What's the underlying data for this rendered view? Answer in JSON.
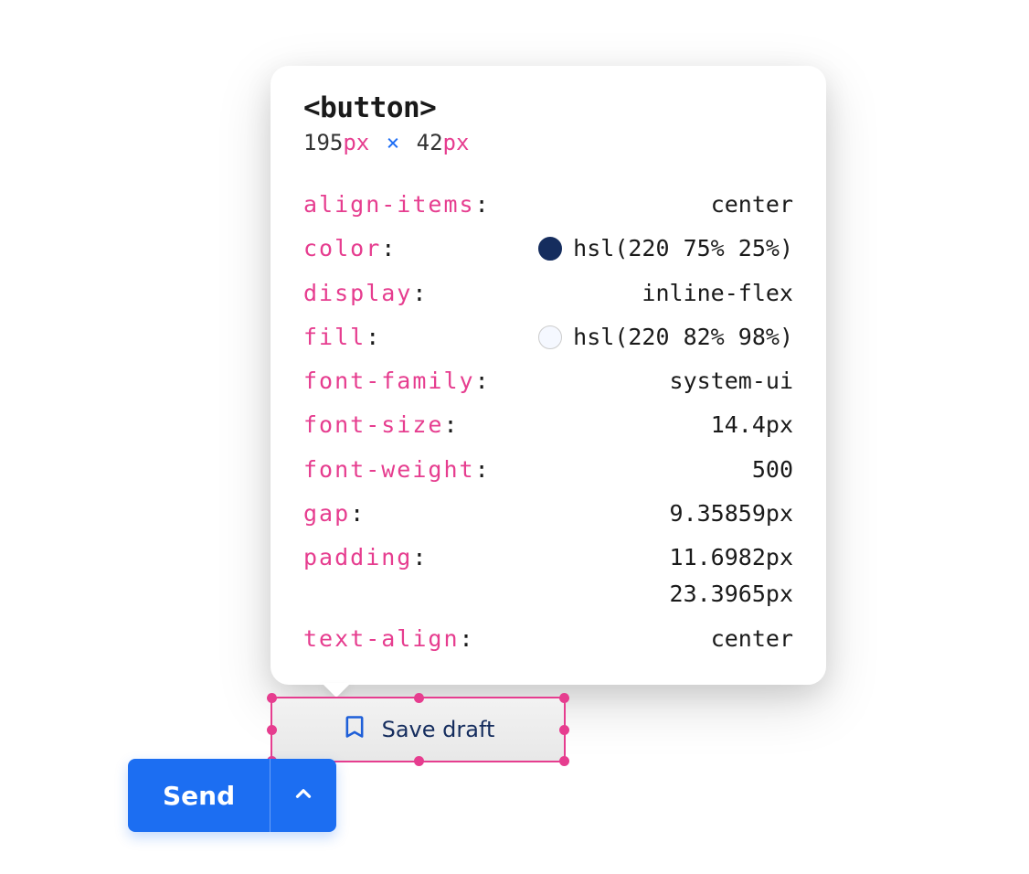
{
  "tooltip": {
    "element_tag": "<button>",
    "dims": {
      "w": "195",
      "h": "42",
      "unit": "px",
      "sep": "×"
    },
    "props": [
      {
        "name": "align-items",
        "value": "center"
      },
      {
        "name": "color",
        "value": "hsl(220 75% 25%)",
        "swatch": "#152d5e"
      },
      {
        "name": "display",
        "value": "inline-flex"
      },
      {
        "name": "fill",
        "value": "hsl(220 82% 98%)",
        "swatch": "#f5f8ff"
      },
      {
        "name": "font-family",
        "value": "system-ui"
      },
      {
        "name": "font-size",
        "value": "14.4px"
      },
      {
        "name": "font-weight",
        "value": "500"
      },
      {
        "name": "gap",
        "value": "9.35859px"
      },
      {
        "name": "padding",
        "value": "11.6982px",
        "value2": "23.3965px"
      },
      {
        "name": "text-align",
        "value": "center"
      }
    ]
  },
  "inspected_button": {
    "label": "Save draft",
    "icon": "bookmark-icon"
  },
  "send_button": {
    "label": "Send"
  }
}
